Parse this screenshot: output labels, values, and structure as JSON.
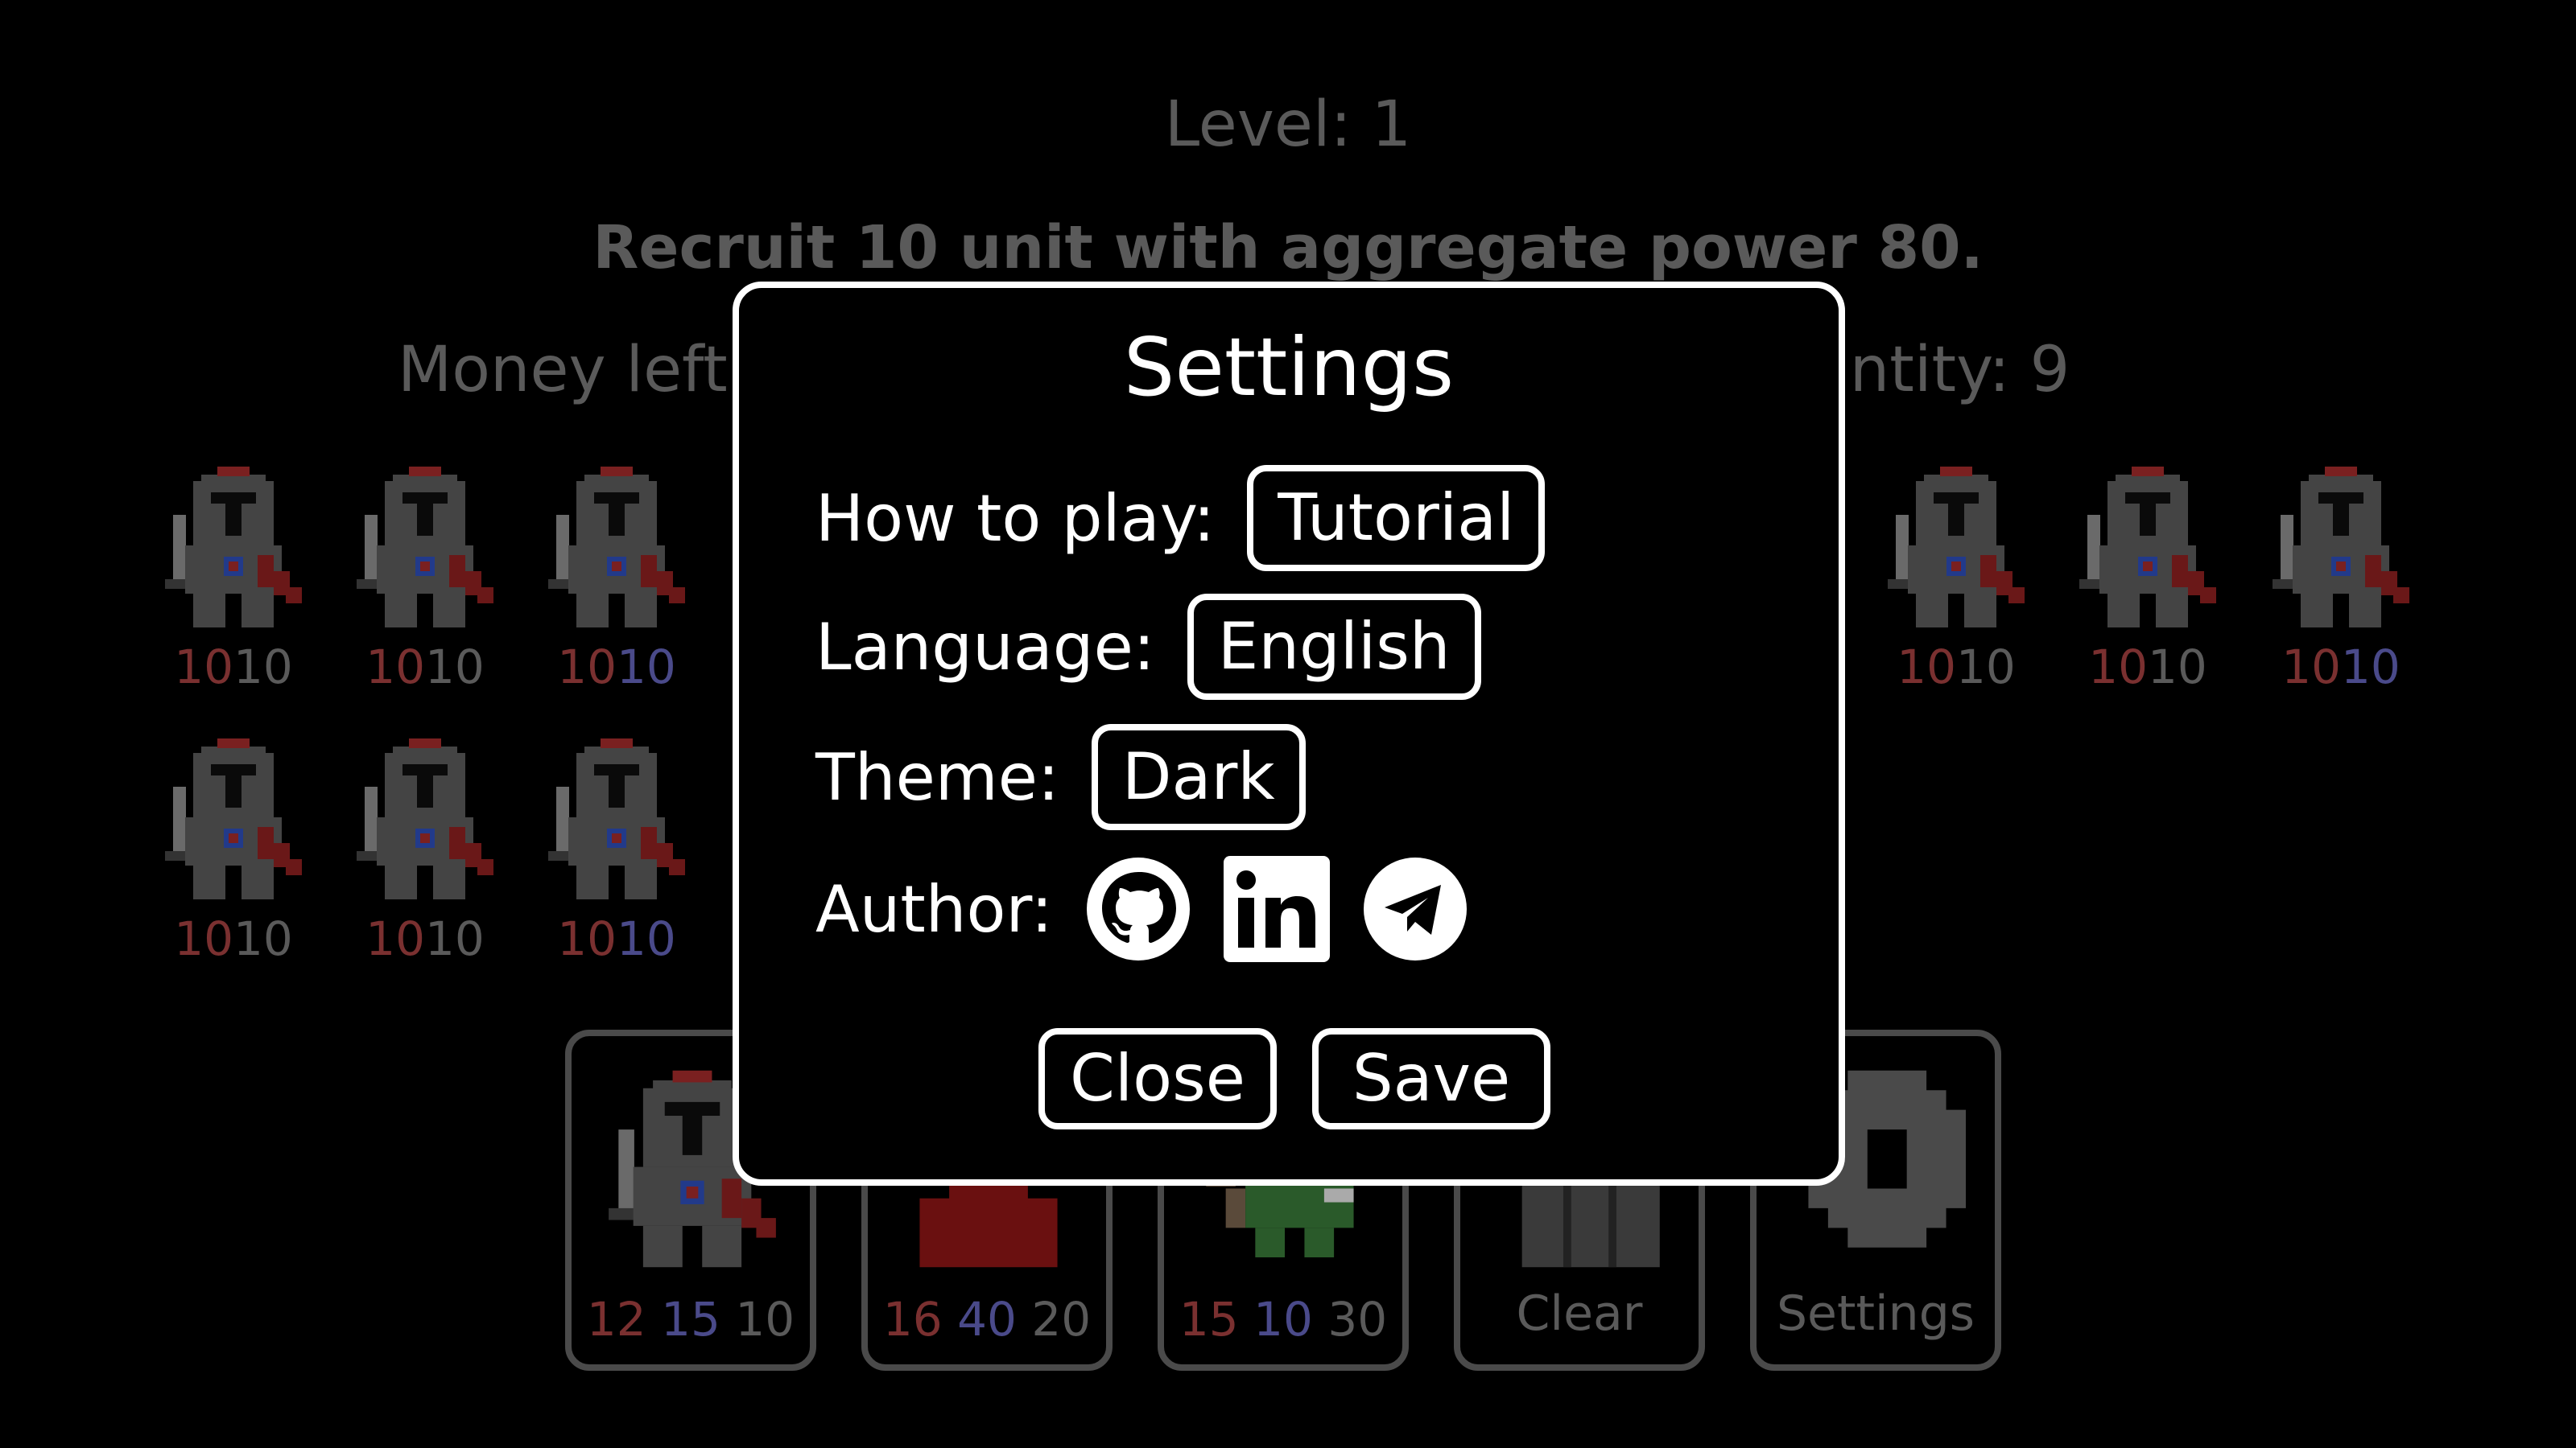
{
  "game": {
    "level_text": "Level: 1",
    "objective_text": "Recruit 10 unit with aggregate power 80.",
    "money_text": "Money left:",
    "quantity_text": "antity: 9"
  },
  "units": [
    {
      "a": "10",
      "b": "10",
      "b_color": "gray"
    },
    {
      "a": "10",
      "b": "10",
      "b_color": "gray"
    },
    {
      "a": "10",
      "b": "10",
      "b_color": "blue"
    },
    {
      "a": "10",
      "b": "10",
      "b_color": "gray"
    },
    {
      "a": "10",
      "b": "10",
      "b_color": "gray"
    },
    {
      "a": "10",
      "b": "10",
      "b_color": "blue"
    },
    {
      "a": "10",
      "b": "10",
      "b_color": "gray"
    },
    {
      "a": "10",
      "b": "10",
      "b_color": "gray"
    },
    {
      "a": "10",
      "b": "10",
      "b_color": "blue"
    }
  ],
  "shop": [
    {
      "kind": "knight",
      "v1": "12",
      "v2": "15",
      "v3": "10"
    },
    {
      "kind": "mage",
      "v1": "16",
      "v2": "40",
      "v3": "20"
    },
    {
      "kind": "archer",
      "v1": "15",
      "v2": "10",
      "v3": "30"
    },
    {
      "kind": "clear",
      "label": "Clear"
    },
    {
      "kind": "settings",
      "label": "Settings"
    }
  ],
  "settings": {
    "title": "Settings",
    "how_to_play_label": "How to play:",
    "tutorial_button": "Tutorial",
    "language_label": "Language:",
    "language_value": "English",
    "theme_label": "Theme:",
    "theme_value": "Dark",
    "author_label": "Author:",
    "author_links": [
      "github-icon",
      "linkedin-icon",
      "telegram-icon"
    ],
    "close_button": "Close",
    "save_button": "Save"
  },
  "colors": {
    "stat_red": "#7a3030",
    "stat_blue": "#4a4a8a",
    "stat_gray": "#5a5a5a",
    "modal_border": "#ffffff",
    "background": "#000000"
  }
}
